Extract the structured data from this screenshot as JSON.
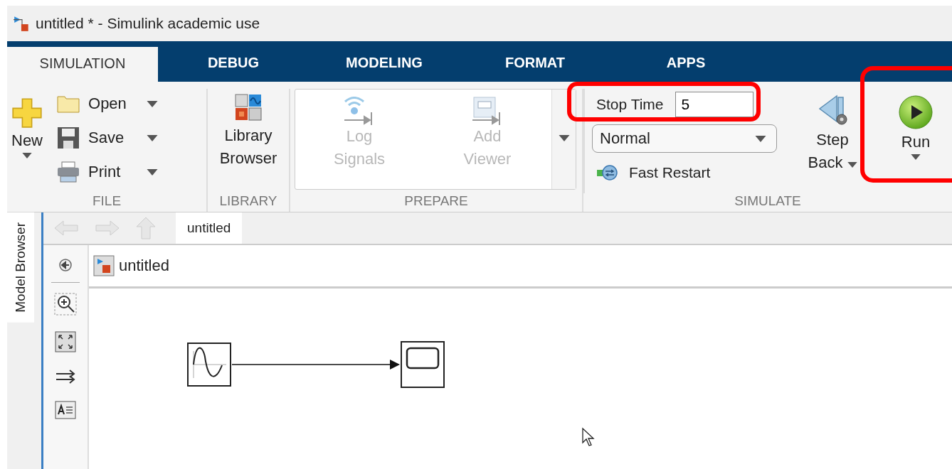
{
  "window": {
    "title": "untitled * - Simulink academic use"
  },
  "tabs": [
    {
      "label": "SIMULATION",
      "selected": true
    },
    {
      "label": "DEBUG",
      "selected": false
    },
    {
      "label": "MODELING",
      "selected": false
    },
    {
      "label": "FORMAT",
      "selected": false
    },
    {
      "label": "APPS",
      "selected": false
    }
  ],
  "file_section": {
    "label": "FILE",
    "new_button": "New",
    "items": [
      {
        "kind": "open",
        "label": "Open"
      },
      {
        "kind": "save",
        "label": "Save"
      },
      {
        "kind": "print",
        "label": "Print"
      }
    ]
  },
  "library_section": {
    "label": "LIBRARY",
    "button": "Library Browser"
  },
  "prepare_section": {
    "label": "PREPARE",
    "buttons": [
      {
        "kind": "log",
        "label": "Log Signals",
        "disabled": true
      },
      {
        "kind": "viewer",
        "label": "Add Viewer",
        "disabled": true
      }
    ]
  },
  "simulate_section": {
    "label": "SIMULATE",
    "stop_time": {
      "label": "Stop Time",
      "value": "5"
    },
    "mode": {
      "value": "Normal"
    },
    "fast_restart": "Fast Restart",
    "step_back": "Step Back",
    "run": "Run"
  },
  "editor": {
    "side_tab": "Model Browser",
    "model_tab": "untitled",
    "breadcrumb": "untitled"
  }
}
